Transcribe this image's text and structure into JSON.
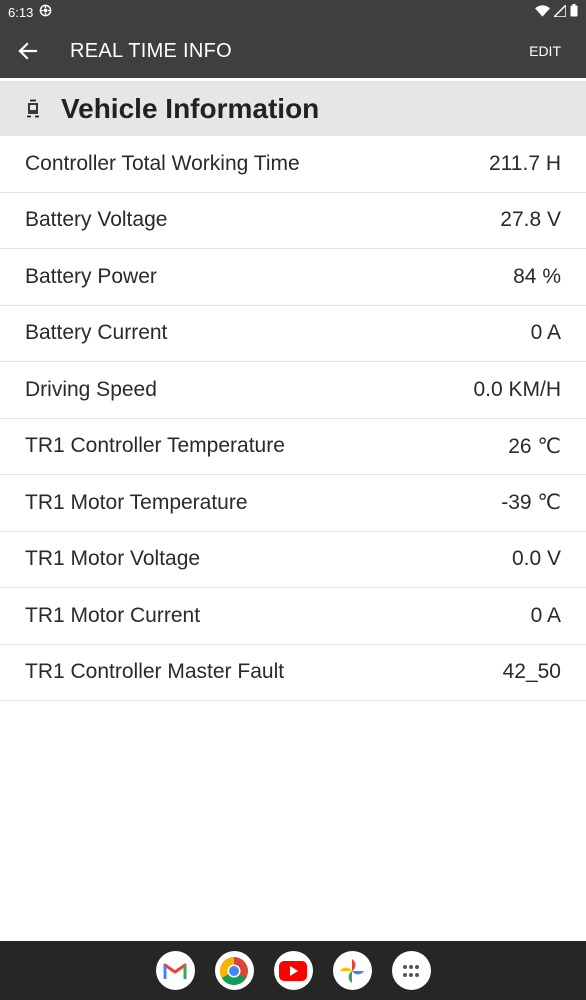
{
  "status_bar": {
    "time": "6:13"
  },
  "app_bar": {
    "title": "REAL TIME INFO",
    "edit_label": "EDIT"
  },
  "section": {
    "title": "Vehicle Information"
  },
  "rows": [
    {
      "label": "Controller Total Working Time",
      "value": "211.7 H"
    },
    {
      "label": "Battery Voltage",
      "value": "27.8 V"
    },
    {
      "label": "Battery Power",
      "value": "84 %"
    },
    {
      "label": "Battery Current",
      "value": "0 A"
    },
    {
      "label": "Driving Speed",
      "value": "0.0 KM/H"
    },
    {
      "label": "TR1 Controller Temperature",
      "value": "26 ℃"
    },
    {
      "label": "TR1 Motor Temperature",
      "value": "-39 ℃"
    },
    {
      "label": "TR1 Motor Voltage",
      "value": "0.0 V"
    },
    {
      "label": "TR1 Motor Current",
      "value": "0 A"
    },
    {
      "label": "TR1 Controller Master Fault",
      "value": "42_50"
    }
  ],
  "nav_apps": [
    "gmail-icon",
    "chrome-icon",
    "youtube-icon",
    "photos-icon",
    "app-drawer-icon"
  ]
}
